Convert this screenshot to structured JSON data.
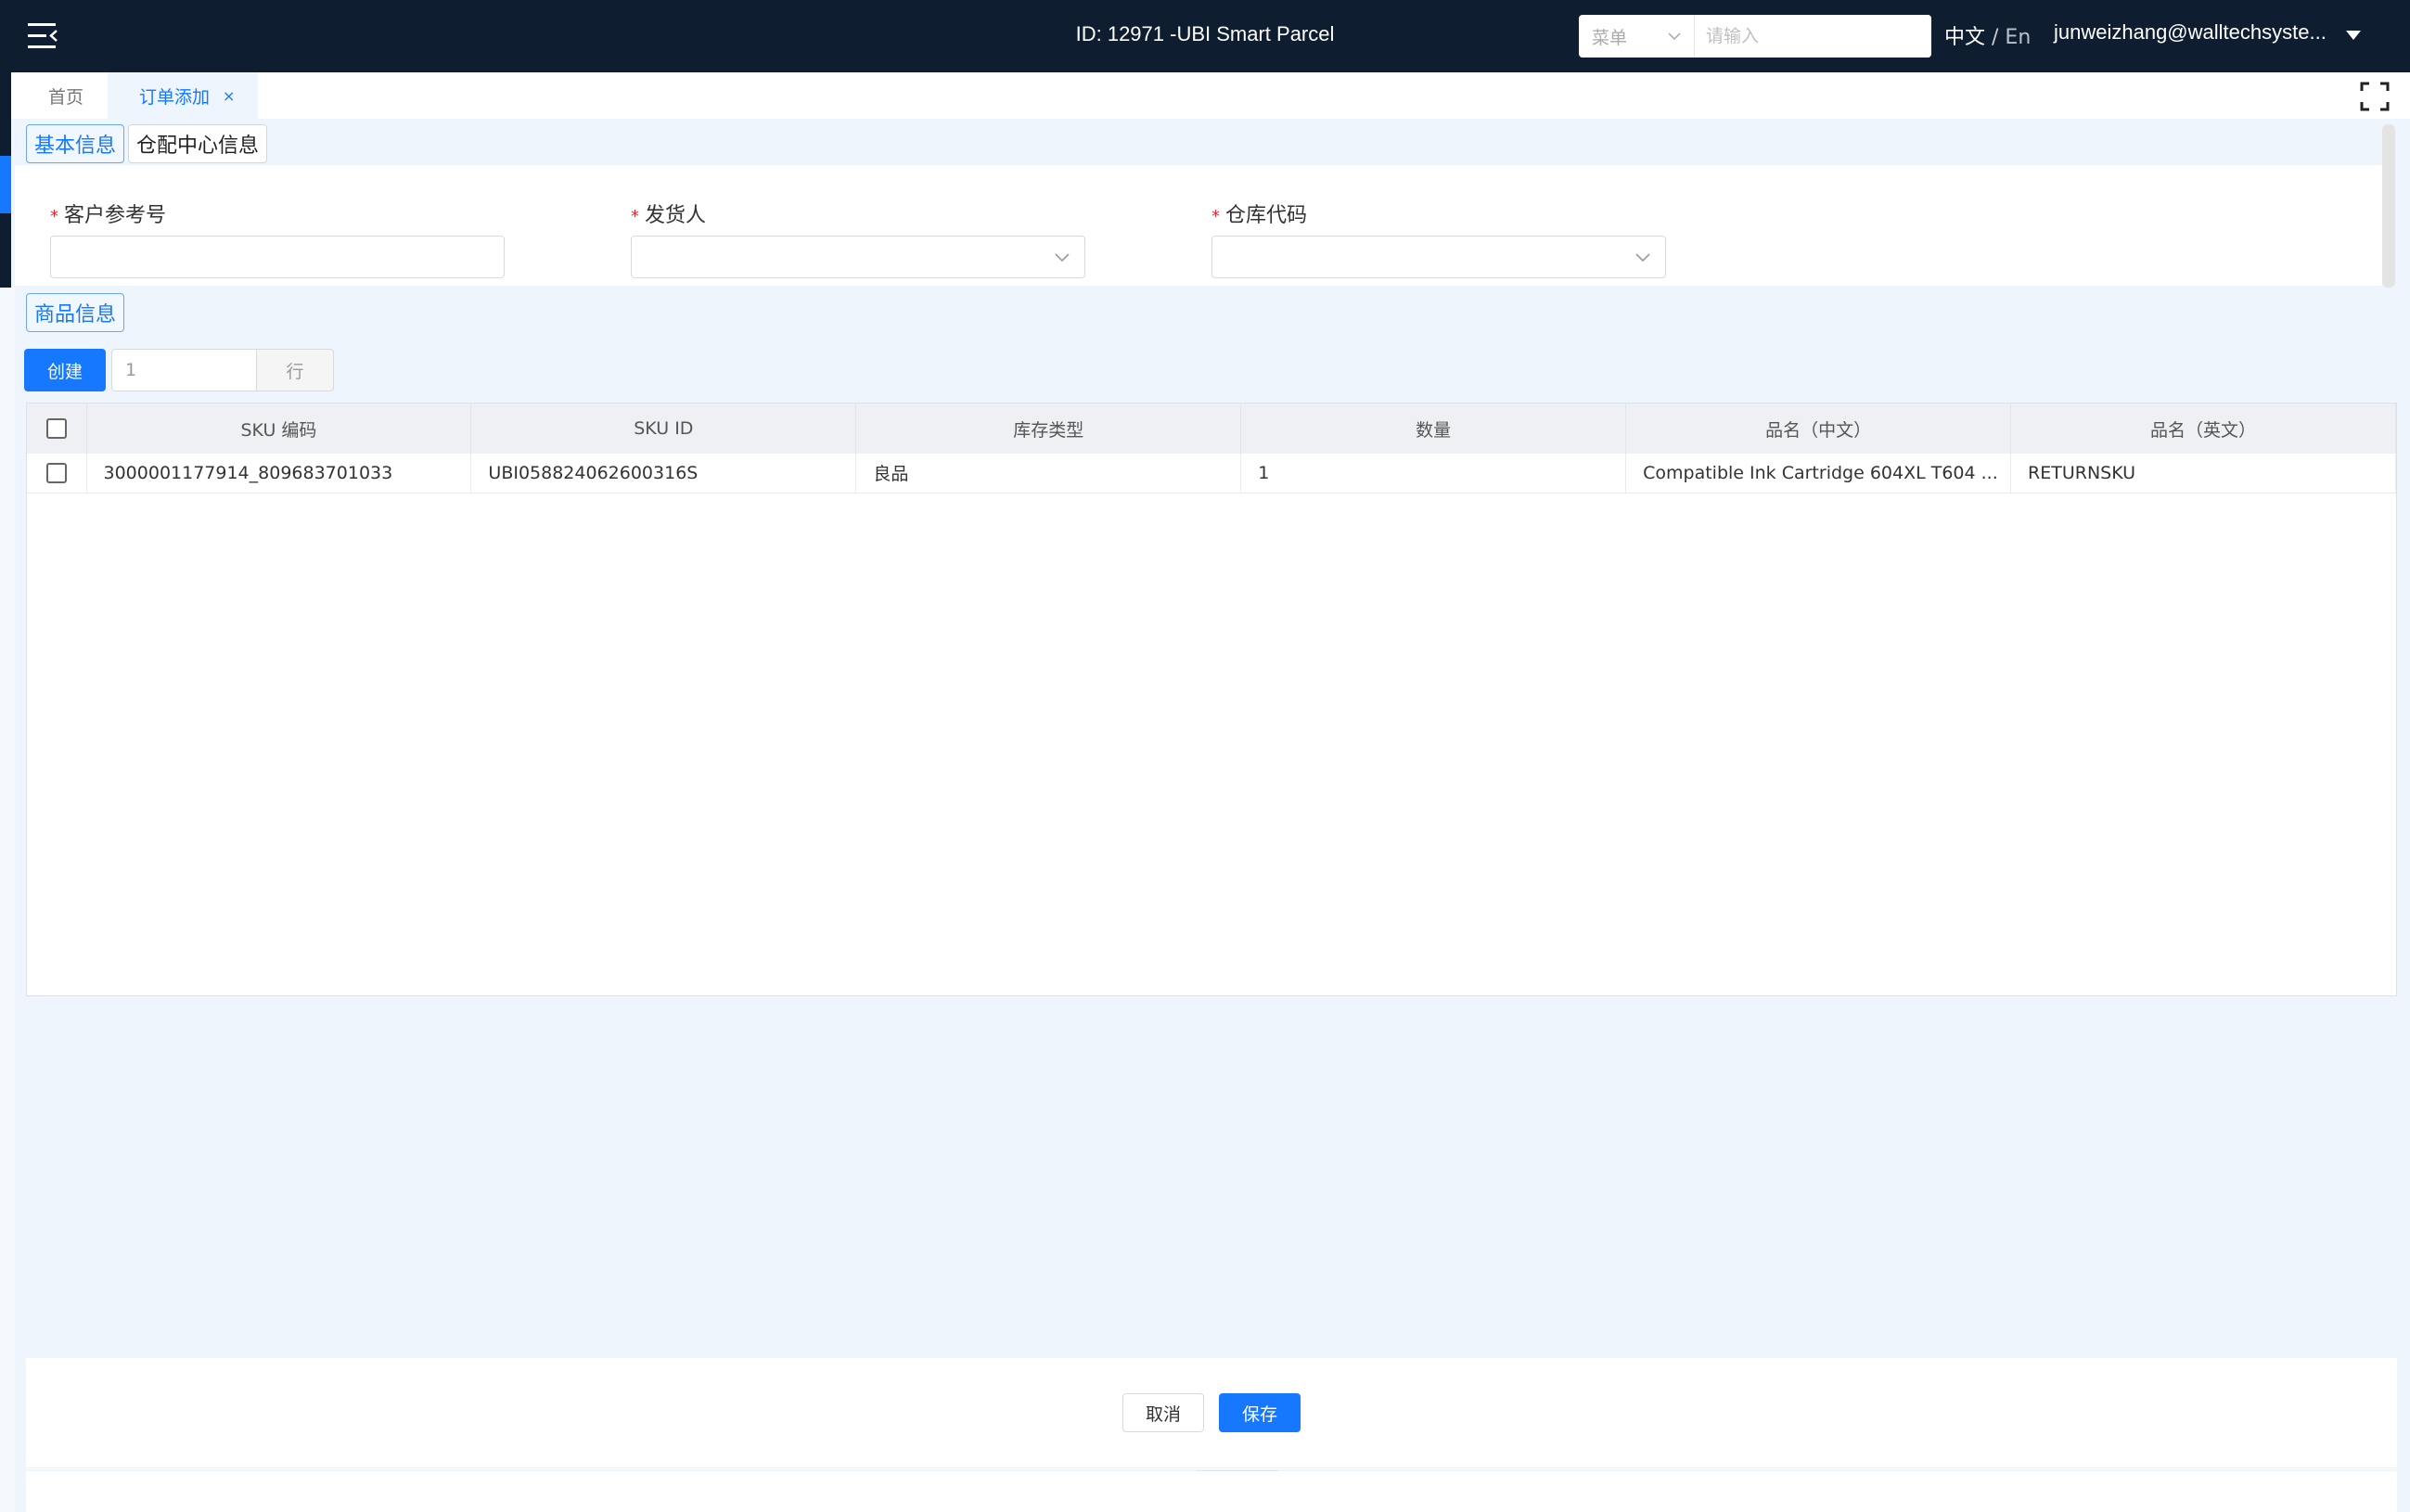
{
  "header": {
    "title": "ID: 12971 -UBI Smart Parcel",
    "menu_select": "菜单",
    "search_placeholder": "请输入",
    "lang_zh": "中文",
    "lang_sep": " / ",
    "lang_en": "En",
    "user": "junweizhang@walltechsyste..."
  },
  "tabs": {
    "home": "首页",
    "order_add": "订单添加",
    "close": "×"
  },
  "sections": {
    "basic": "基本信息",
    "warehouse_center": "仓配中心信息",
    "goods": "商品信息"
  },
  "form": {
    "customer_ref": {
      "label": "客户参考号",
      "value": ""
    },
    "shipper": {
      "label": "发货人",
      "value": ""
    },
    "warehouse_code": {
      "label": "仓库代码",
      "value": ""
    },
    "required_mark": "*"
  },
  "goods": {
    "create_label": "创建",
    "rows_value": "1",
    "rows_suffix": "行",
    "columns": [
      "SKU 编码",
      "SKU ID",
      "库存类型",
      "数量",
      "品名（中文）",
      "品名（英文）"
    ],
    "rows": [
      [
        "3000001177914_809683701033",
        "UBI058824062600316S",
        "良品",
        "1",
        "Compatible Ink Cartridge 604XL T604 ...",
        "RETURNSKU"
      ]
    ]
  },
  "footer": {
    "cancel": "取消",
    "save": "保存"
  },
  "colors": {
    "topbar": "#0f1d31",
    "primary": "#1677ff",
    "background": "#eef5fd",
    "required": "#f5222d"
  }
}
